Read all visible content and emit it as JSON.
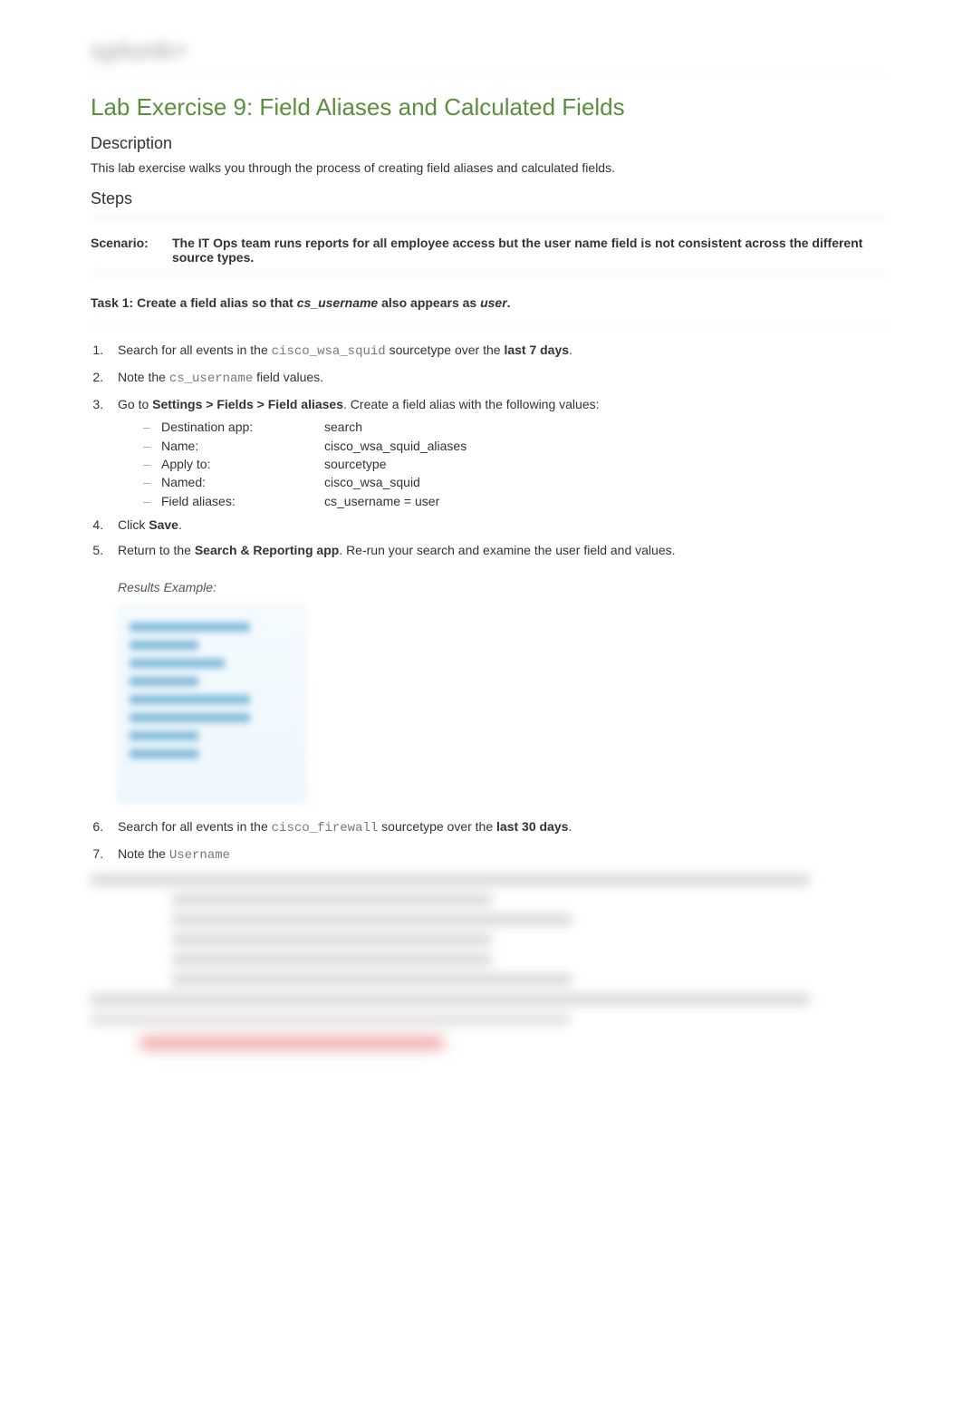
{
  "logo": "splunk>",
  "heading": "Lab Exercise 9: Field Aliases and Calculated Fields",
  "description_heading": "Description",
  "description_text": "This lab exercise walks you through the process of creating field aliases and calculated fields.",
  "steps_heading": "Steps",
  "scenario_label": "Scenario:",
  "scenario_text": "The IT Ops team runs reports for all employee access but the user name field is not consistent across the different source types.",
  "task1": {
    "prefix": "Task 1: Create a field alias so that ",
    "code1": "cs_username",
    "mid": " also appears as ",
    "code2": "user",
    "suffix": "."
  },
  "steps": {
    "s1_a": "Search for all events in the ",
    "s1_code": "cisco_wsa_squid",
    "s1_b": " sourcetype over the ",
    "s1_bold": "last 7 days",
    "s1_c": ".",
    "s2_a": "Note the ",
    "s2_code": "cs_username",
    "s2_b": " field values.",
    "s3_a": "Go to ",
    "s3_bold": "Settings > Fields > Field aliases",
    "s3_b": ". Create a field alias with the following values:",
    "kv": [
      {
        "k": "Destination app:",
        "v": "search"
      },
      {
        "k": "Name:",
        "v": "cisco_wsa_squid_aliases"
      },
      {
        "k": "Apply to:",
        "v": "sourcetype"
      },
      {
        "k": "Named:",
        "v": "cisco_wsa_squid"
      },
      {
        "k": "Field aliases:",
        "v": "cs_username = user"
      }
    ],
    "s4_a": "Click ",
    "s4_bold": "Save",
    "s4_b": ".",
    "s5_a": "Return to the ",
    "s5_bold": "Search & Reporting app",
    "s5_b": ". Re-run your search and examine the user field and values.",
    "results_label": "Results Example:",
    "s6_a": "Search for all events in the ",
    "s6_code": "cisco_firewall",
    "s6_b": " sourcetype over the ",
    "s6_bold": "last 30 days",
    "s6_c": ".",
    "s7_a": "Note the ",
    "s7_code": "Username"
  }
}
